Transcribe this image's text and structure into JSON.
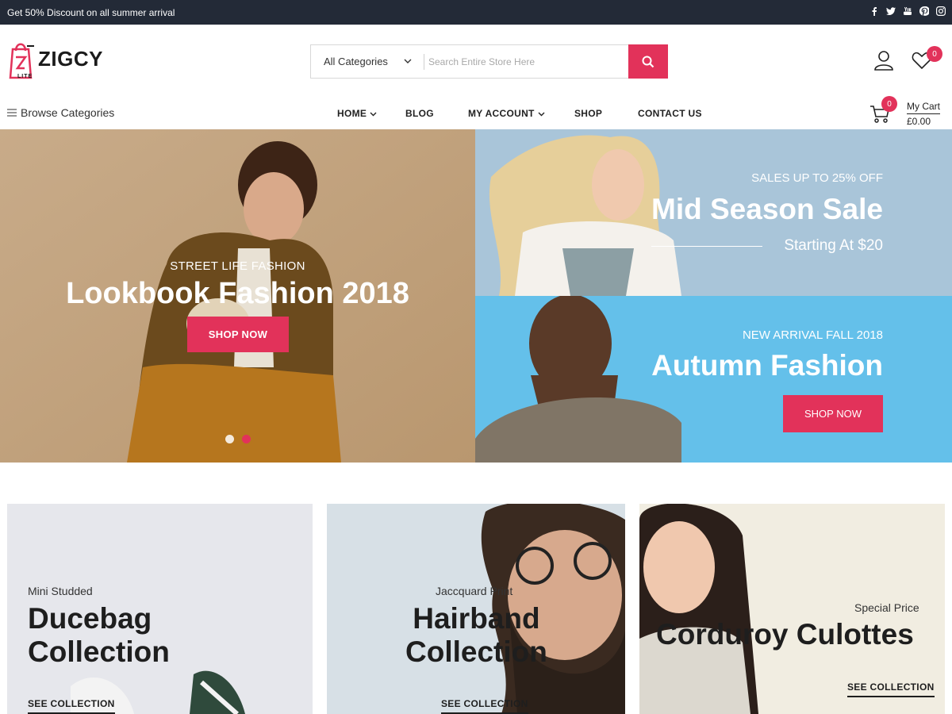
{
  "topbar": {
    "promo": "Get 50% Discount on all summer arrival",
    "socials": [
      "facebook-icon",
      "twitter-icon",
      "youtube-icon",
      "pinterest-icon",
      "instagram-icon"
    ]
  },
  "brand": {
    "name": "ZIGCY",
    "sub": "LITE",
    "accent": "#e2325a",
    "dark": "#232a37"
  },
  "search": {
    "category": "All Categories",
    "placeholder": "Search Entire Store Here",
    "value": ""
  },
  "header": {
    "wishlist_count": "0"
  },
  "nav": {
    "browse": "Browse Categories",
    "items": [
      {
        "label": "HOME",
        "dropdown": true
      },
      {
        "label": "BLOG",
        "dropdown": false
      },
      {
        "label": "MY ACCOUNT",
        "dropdown": true
      },
      {
        "label": "SHOP",
        "dropdown": false
      },
      {
        "label": "CONTACT US",
        "dropdown": false
      }
    ],
    "cart": {
      "label": "My Cart",
      "total": "£0.00",
      "count": "0"
    }
  },
  "hero": {
    "left": {
      "eyebrow": "STREET LIFE FASHION",
      "title": "Lookbook Fashion 2018",
      "button": "SHOP NOW"
    },
    "right_top": {
      "eyebrow": "SALES UP TO 25% OFF",
      "title": "Mid Season Sale",
      "subtitle": "Starting At $20"
    },
    "right_bottom": {
      "eyebrow": "NEW ARRIVAL FALL 2018",
      "title": "Autumn Fashion",
      "button": "SHOP NOW"
    }
  },
  "collections": [
    {
      "eyebrow": "Mini Studded",
      "title_line1": "Ducebag",
      "title_line2": "Collection",
      "link": "SEE COLLECTION"
    },
    {
      "eyebrow": "Jaccquard Print",
      "title_line1": "Hairband",
      "title_line2": "Collection",
      "link": "SEE COLLECTION"
    },
    {
      "eyebrow": "Special Price",
      "title_line1": "Corduroy Culottes",
      "link": "SEE COLLECTION"
    }
  ]
}
